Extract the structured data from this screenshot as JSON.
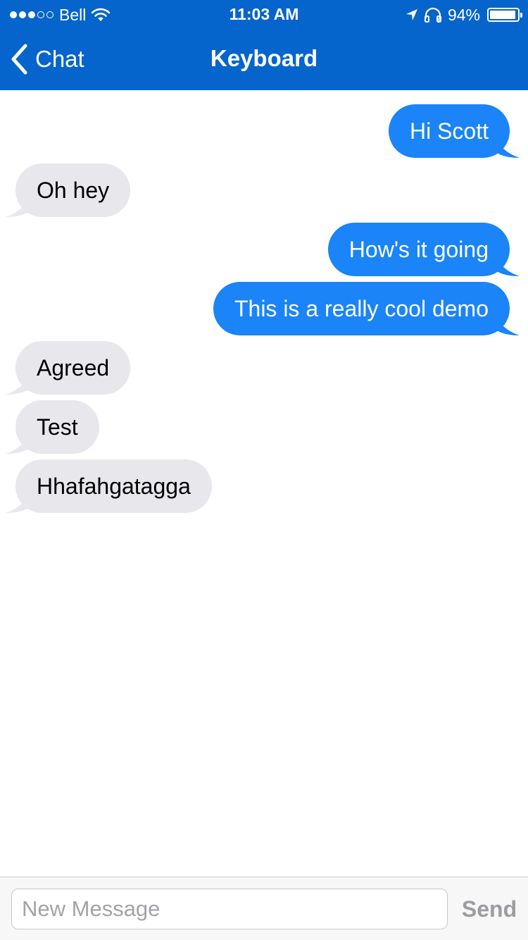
{
  "status_bar": {
    "carrier": "Bell",
    "time": "11:03 AM",
    "battery_percent_text": "94%",
    "battery_level": 0.94,
    "signal_bars_filled": 3,
    "signal_bars_total": 5,
    "icons": [
      "wifi-icon",
      "location-arrow-icon",
      "headphones-icon",
      "battery-icon"
    ]
  },
  "nav": {
    "back_label": "Chat",
    "title": "Keyboard"
  },
  "messages": [
    {
      "text": "Hi Scott",
      "direction": "outgoing"
    },
    {
      "text": "Oh hey",
      "direction": "incoming"
    },
    {
      "text": "How's it going",
      "direction": "outgoing"
    },
    {
      "text": "This is a really cool demo",
      "direction": "outgoing"
    },
    {
      "text": "Agreed",
      "direction": "incoming"
    },
    {
      "text": "Test",
      "direction": "incoming"
    },
    {
      "text": "Hhafahgatagga",
      "direction": "incoming"
    }
  ],
  "composer": {
    "placeholder": "New Message",
    "value": "",
    "send_label": "Send"
  },
  "colors": {
    "header_blue": "#0565cc",
    "outgoing_bubble": "#1a84f8",
    "incoming_bubble": "#e7e7ec",
    "send_disabled": "#9c9ca1"
  }
}
